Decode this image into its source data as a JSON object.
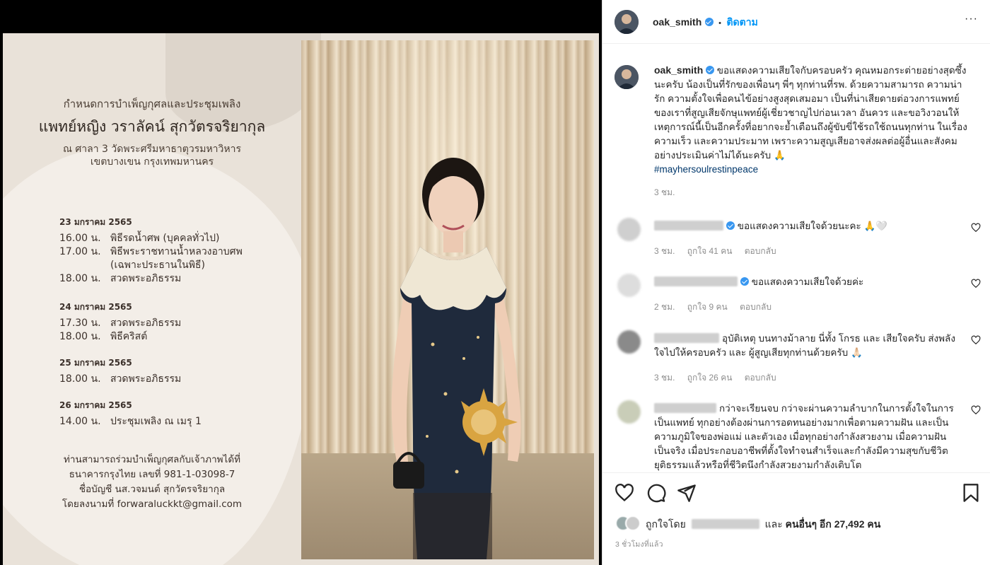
{
  "invitation": {
    "line1": "กำหนดการบำเพ็ญกุศลและประชุมเพลิง",
    "name": "แพทย์หญิง วราลัคน์ สุกวัตรจริยากุล",
    "place1": "ณ ศาลา 3 วัดพระศรีมหาธาตุวรมหาวิหาร",
    "place2": "เขตบางเขน กรุงเทพมหานคร",
    "days": [
      {
        "date": "23 มกราคม 2565",
        "rows": [
          {
            "time": "16.00 น.",
            "text": "พิธีรดน้ำศพ (บุคคลทั่วไป)"
          },
          {
            "time": "17.00 น.",
            "text": "พิธีพระราชทานน้ำหลวงอาบศพ"
          },
          {
            "time": "",
            "text": "(เฉพาะประธานในพิธี)"
          },
          {
            "time": "18.00 น.",
            "text": "สวดพระอภิธรรม"
          }
        ]
      },
      {
        "date": "24 มกราคม 2565",
        "rows": [
          {
            "time": "17.30 น.",
            "text": "สวดพระอภิธรรม"
          },
          {
            "time": "18.00 น.",
            "text": "พิธีคริสต์"
          }
        ]
      },
      {
        "date": "25 มกราคม 2565",
        "rows": [
          {
            "time": "18.00 น.",
            "text": "สวดพระอภิธรรม"
          }
        ]
      },
      {
        "date": "26 มกราคม 2565",
        "rows": [
          {
            "time": "14.00 น.",
            "text": "ประชุมเพลิง ณ เมรุ 1"
          }
        ]
      }
    ],
    "bank1": "ท่านสามารถร่วมบำเพ็ญกุศลกับเจ้าภาพได้ที่",
    "bank2": "ธนาคารกรุงไทย เลขที่ 981-1-03098-7",
    "bank3": "ชื่อบัญชี นส.วจมนต์ สุกวัตรจริยากุล",
    "bank4": "โดยลงนามที่ forwaraluckkt@gmail.com"
  },
  "header": {
    "username": "oak_smith",
    "separator": "•",
    "follow_label": "ติดตาม",
    "more_label": "···"
  },
  "caption": {
    "username": "oak_smith",
    "text": "ขอแสดงความเสียใจกับครอบครัว คุณหมอกระต่ายอย่างสุดซึ้งนะครับ น้องเป็นที่รักของเพื่อนๆ พี่ๆ ทุกท่านที่รพ. ด้วยความสามารถ ความน่ารัก ความตั้งใจเพื่อคนไข้อย่างสูงสุดเสมอมา เป็นที่น่าเสียดายต่อวงการแพทย์ของเราที่สูญเสียจักษุแพทย์ผู้เชี่ยวชาญไปก่อนเวลา อันควร และขอวิงวอนให้เหตุการณ์นี้เป็นอีกครั้งที่อยากจะย้ำเตือนถึงผู้ขับขี่ใช้รถใช้ถนนทุกท่าน ในเรื่องความเร็ว และความประมาท เพราะความสูญเสียอาจส่งผลต่อผู้อื่นและสังคมอย่างประเมินค่าไม่ได้นะครับ 🙏",
    "hashtag": "#mayhersoulrestinpeace",
    "time": "3 ชม."
  },
  "comments": [
    {
      "text": "ขอแสดงความเสียใจด้วยนะคะ 🙏🤍",
      "time": "3 ชม.",
      "likes": "ถูกใจ 41 คน",
      "reply": "ตอบกลับ"
    },
    {
      "text": "ขอแสดงความเสียใจด้วยค่ะ",
      "time": "2 ชม.",
      "likes": "ถูกใจ 9 คน",
      "reply": "ตอบกลับ"
    },
    {
      "text": "อุบัติเหตุ บนทางม้าลาย นี่ทั้ง โกรธ และ เสียใจครับ ส่งพลังใจไปให้ครอบครัว และ ผู้สูญเสียทุกท่านด้วยครับ 🙏🏻",
      "time": "3 ชม.",
      "likes": "ถูกใจ 26 คน",
      "reply": "ตอบกลับ"
    },
    {
      "text": "กว่าจะเรียนจบ กว่าจะผ่านความลำบากในการตั้งใจในการเป็นแพทย์ ทุกอย่างต้องผ่านการอดทนอย่างมากเพื่อตามความฝัน และเป็นความภูมิใจของพ่อแม่ และตัวเอง เมื่อทุกอย่างกำลังสวยงาม เมื่อความฝันเป็นจริง เมื่อประกอบอาชีพที่ตั้งใจทำจนสำเร็จและกำลังมีความสุขกับชีวิต ยุติธรรมแล้วหรือที่ชีวิตนึงกำลังสวยงามกำลังเติบโต"
    }
  ],
  "likes": {
    "prefix": "ถูกใจโดย",
    "middle": "และ",
    "others": "คนอื่นๆ อีก 27,492 คน"
  },
  "posted": "3 ชั่วโมงที่แล้ว"
}
